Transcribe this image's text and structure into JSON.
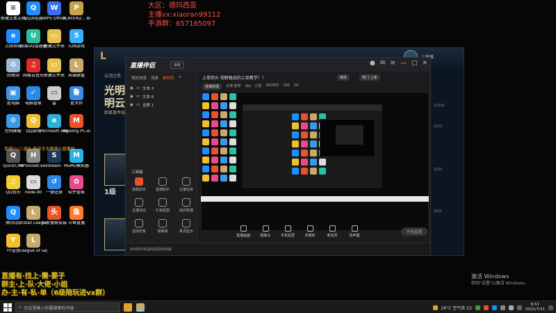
{
  "overlay": {
    "line1": "大区：德玛西亚",
    "line2": "主播vx:xiaoran99112",
    "line3": "手游群：657165097"
  },
  "banner": {
    "line1": "直播有·找上·需·要子",
    "line2": "群主·上·队·大佬·小姐",
    "line3": "办·主·有·私·单（6级陪玩进vx群）"
  },
  "welcome": {
    "prefix": "欢迎",
    "name": "SV21",
    "suffix": "涵头·布丝王大佬进入直播间"
  },
  "desktop_icons": [
    {
      "label": "新建文本文档",
      "color": "#ffffff",
      "glyph": "≡"
    },
    {
      "label": "QQ浏览器",
      "color": "#1f8cff",
      "glyph": "Q"
    },
    {
      "label": "WPS Office",
      "color": "#3a6fe8",
      "glyph": "W"
    },
    {
      "label": "PLAYERU... BATTLEGR...",
      "color": "#c8a24a",
      "glyph": "P"
    },
    {
      "label": "上网导航",
      "color": "#1f8cff",
      "glyph": "e"
    },
    {
      "label": "网易UU加速器",
      "color": "#2bc0a0",
      "glyph": "U"
    },
    {
      "label": "新建文件夹",
      "color": "#e8c24a",
      "glyph": "▭"
    },
    {
      "label": "528游戏",
      "color": "#3ab0ff",
      "glyph": "5"
    },
    {
      "label": "回收站",
      "color": "#9ab8d8",
      "glyph": "♻"
    },
    {
      "label": "网易云音乐",
      "color": "#e02b2b",
      "glyph": "♫"
    },
    {
      "label": "新建文件夹",
      "color": "#e8c24a",
      "glyph": "▭"
    },
    {
      "label": "英雄联盟",
      "color": "#c8aa6e",
      "glyph": "L"
    },
    {
      "label": "此电脑",
      "color": "#3a9ae8",
      "glyph": "▣"
    },
    {
      "label": "电脑管家",
      "color": "#2b8ae8",
      "glyph": "✓"
    },
    {
      "label": "雷",
      "color": "#cccccc",
      "glyph": "▭"
    },
    {
      "label": "鲁大师",
      "color": "#3a8ae8",
      "glyph": "鲁"
    },
    {
      "label": "控制面板",
      "color": "#3a9ae8",
      "glyph": "⚙"
    },
    {
      "label": "QQ游戏",
      "color": "#f0c030",
      "glyph": "Q"
    },
    {
      "label": "Microsoft Edge",
      "color": "#2bb0d8",
      "glyph": "e"
    },
    {
      "label": "MLoong PC.exe",
      "color": "#e8532a",
      "glyph": "M"
    },
    {
      "label": "QuickCPU",
      "color": "#555555",
      "glyph": "Q"
    },
    {
      "label": "HPSocket.exe",
      "color": "#888888",
      "glyph": "H"
    },
    {
      "label": "Steam",
      "color": "#1b3a5a",
      "glyph": "S"
    },
    {
      "label": "MuMu模拟器",
      "color": "#2bb0e8",
      "glyph": "M"
    },
    {
      "label": "QQ音乐",
      "color": "#f0d030",
      "glyph": "♫"
    },
    {
      "label": "node.dll",
      "color": "#dddddd",
      "glyph": "▭"
    },
    {
      "label": "一键还原",
      "color": "#2b8ae8",
      "glyph": "↺"
    },
    {
      "label": "软件管家",
      "color": "#e84a8a",
      "glyph": "✿"
    },
    {
      "label": "腾讯QQ",
      "color": "#1f8cff",
      "glyph": "Q"
    },
    {
      "label": "Install League of...",
      "color": "#c8aa6e",
      "glyph": "L"
    },
    {
      "label": "头条搜索安装",
      "color": "#e8532a",
      "glyph": "头"
    },
    {
      "label": "斗鱼直播",
      "color": "#ff7a2a",
      "glyph": "鱼"
    },
    {
      "label": "YY语音",
      "color": "#f0c030",
      "glyph": "Y"
    },
    {
      "label": "League of Legends",
      "color": "#c8aa6e",
      "glyph": "L"
    }
  ],
  "lol": {
    "tab": "云顶之弈",
    "title": "光明云",
    "title2": "明云",
    "sub": "距离事件结束",
    "level": "1级",
    "user": "儿被谁",
    "notes": [
      "(1/14)",
      "(0/3)",
      "(0/3)",
      "(0/3)"
    ]
  },
  "zb": {
    "brand": "直播伴侣",
    "ver": "旗舰",
    "ltabs": [
      "我的场景",
      "场景",
      "素材库"
    ],
    "sources": [
      "文本 3",
      "文本 6",
      "全屏 1"
    ],
    "tools_title": "工具箱",
    "tools": [
      "弹幕助手",
      "直播助手",
      "主播任务",
      "主播活动",
      "礼物星图",
      "房间管理",
      "虚拟形象",
      "弹幕墙",
      "歌词显示"
    ],
    "rtitle": "上单狗头 视野极品的上单教学！！",
    "btn1": "修改",
    "btn2": "热门·上单",
    "meta": [
      "直播管理",
      "大神·皮罗",
      "Sky · 小然",
      "582055",
      "246",
      "54"
    ],
    "bottom": [
      "直播画面",
      "摄像头",
      "手机投屏",
      "多媒体",
      "麦克风",
      "扬声器"
    ],
    "start": "开始直播",
    "foot": "如何把手机游戏投屏到电脑"
  },
  "activate": {
    "line1": "激活 Windows",
    "line2": "转到\"设置\"以激活 Windows。"
  },
  "taskbar": {
    "search": "在这里输入你要搜索的内容",
    "weather": "26°C  空气良 53",
    "time": "8:51",
    "date": "2021/7/31"
  }
}
